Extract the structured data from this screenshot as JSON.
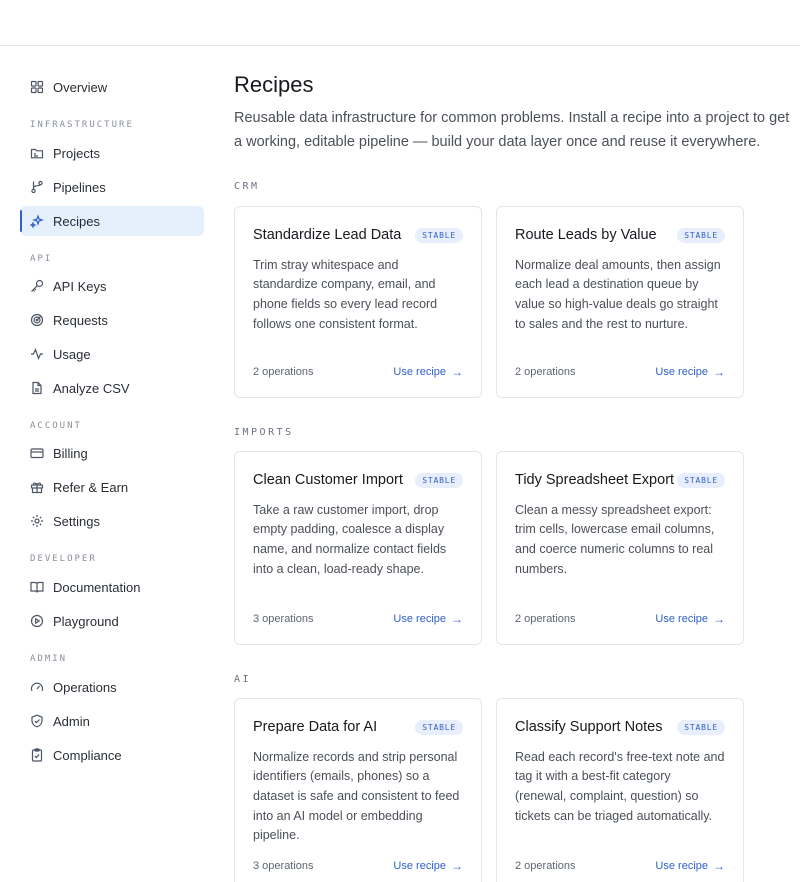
{
  "sidebar": {
    "overview": "Overview",
    "sections": {
      "infrastructure": "INFRASTRUCTURE",
      "api": "API",
      "account": "ACCOUNT",
      "developer": "DEVELOPER",
      "admin": "ADMIN"
    },
    "items": {
      "projects": "Projects",
      "pipelines": "Pipelines",
      "recipes": "Recipes",
      "api_keys": "API Keys",
      "requests": "Requests",
      "usage": "Usage",
      "analyze_csv": "Analyze CSV",
      "billing": "Billing",
      "refer": "Refer & Earn",
      "settings": "Settings",
      "documentation": "Documentation",
      "playground": "Playground",
      "operations": "Operations",
      "admin": "Admin",
      "compliance": "Compliance"
    }
  },
  "main": {
    "title": "Recipes",
    "description": "Reusable data infrastructure for common problems. Install a recipe into a project to get a working, editable pipeline — build your data layer once and reuse it everywhere.",
    "categories": {
      "crm": "CRM",
      "imports": "IMPORTS",
      "ai": "AI"
    },
    "cards": [
      {
        "title": "Standardize Lead Data",
        "badge": "STABLE",
        "desc": "Trim stray whitespace and standardize company, email, and phone fields so every lead record follows one consistent format.",
        "ops": "2 operations",
        "cta": "Use recipe"
      },
      {
        "title": "Route Leads by Value",
        "badge": "STABLE",
        "desc": "Normalize deal amounts, then assign each lead a destination queue by value so high-value deals go straight to sales and the rest to nurture.",
        "ops": "2 operations",
        "cta": "Use recipe"
      },
      {
        "title": "Clean Customer Import",
        "badge": "STABLE",
        "desc": "Take a raw customer import, drop empty padding, coalesce a display name, and normalize contact fields into a clean, load-ready shape.",
        "ops": "3 operations",
        "cta": "Use recipe"
      },
      {
        "title": "Tidy Spreadsheet Export",
        "badge": "STABLE",
        "desc": "Clean a messy spreadsheet export: trim cells, lowercase email columns, and coerce numeric columns to real numbers.",
        "ops": "2 operations",
        "cta": "Use recipe"
      },
      {
        "title": "Prepare Data for AI",
        "badge": "STABLE",
        "desc": "Normalize records and strip personal identifiers (emails, phones) so a dataset is safe and consistent to feed into an AI model or embedding pipeline.",
        "ops": "3 operations",
        "cta": "Use recipe"
      },
      {
        "title": "Classify Support Notes",
        "badge": "STABLE",
        "desc": "Read each record's free-text note and tag it with a best-fit category (renewal, complaint, question) so tickets can be triaged automatically.",
        "ops": "2 operations",
        "cta": "Use recipe"
      }
    ]
  },
  "colors": {
    "accent": "#2f62c9",
    "active_bg": "#e6effc",
    "border": "#e3e6ea"
  }
}
